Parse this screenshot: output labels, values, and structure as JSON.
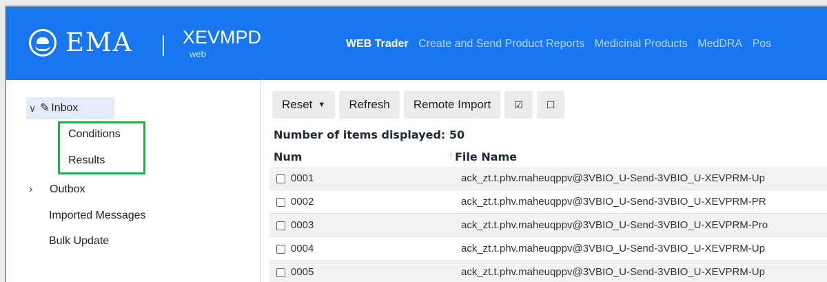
{
  "header": {
    "brand": "EMA",
    "module": "XEVMPD",
    "module_sub": "web",
    "nav": [
      {
        "label": "WEB Trader",
        "active": true
      },
      {
        "label": "Create and Send Product Reports",
        "active": false
      },
      {
        "label": "Medicinal Products",
        "active": false
      },
      {
        "label": "MedDRA",
        "active": false
      },
      {
        "label": "Pos",
        "active": false
      }
    ]
  },
  "sidebar": {
    "inbox": "Inbox",
    "inbox_children": [
      "Conditions",
      "Results"
    ],
    "outbox": "Outbox",
    "items": [
      "Imported Messages",
      "Bulk Update"
    ]
  },
  "toolbar": {
    "reset": "Reset",
    "refresh": "Refresh",
    "remote_import": "Remote Import",
    "check_all": "☑",
    "uncheck_all": "☐"
  },
  "list": {
    "count_label": "Number of items displayed: 50",
    "col_num": "Num",
    "col_file": "File Name",
    "rows": [
      {
        "num": "0001",
        "file": "ack_zt.t.phv.maheuqppv@3VBIO_U-Send-3VBIO_U-XEVPRM-Up"
      },
      {
        "num": "0002",
        "file": "ack_zt.t.phv.maheuqppv@3VBIO_U-Send-3VBIO_U-XEVPRM-PR"
      },
      {
        "num": "0003",
        "file": "ack_zt.t.phv.maheuqppv@3VBIO_U-Send-3VBIO_U-XEVPRM-Pro"
      },
      {
        "num": "0004",
        "file": "ack_zt.t.phv.maheuqppv@3VBIO_U-Send-3VBIO_U-XEVPRM-Up"
      },
      {
        "num": "0005",
        "file": "ack_zt.t.phv.maheuqppv@3VBIO_U-Send-3VBIO_U-XEVPRM-Up"
      }
    ]
  },
  "colors": {
    "header_bg": "#1877ee",
    "highlight_box": "#2aaa4a",
    "selected_bg": "#e3ecf9"
  }
}
